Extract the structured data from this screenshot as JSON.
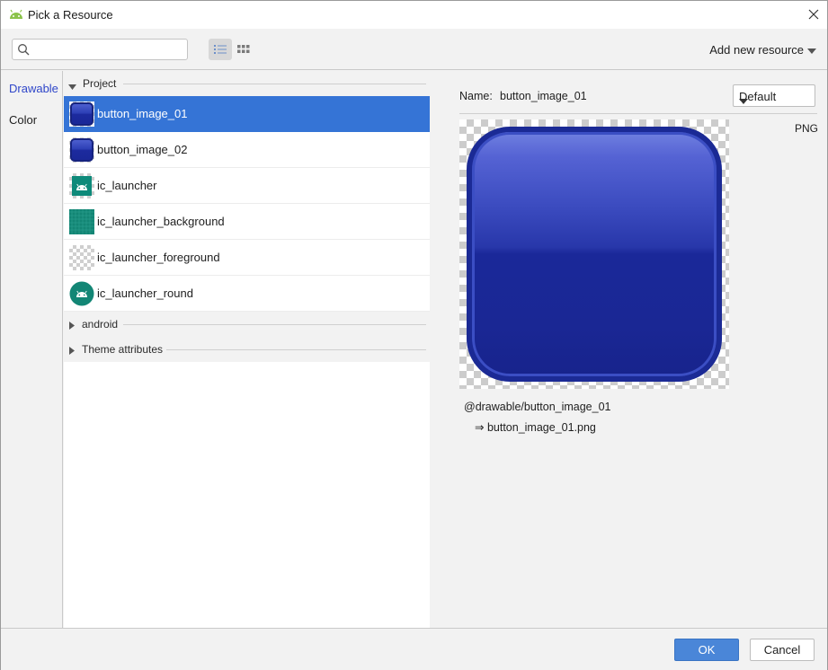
{
  "window": {
    "title": "Pick a Resource",
    "app_icon": "android-icon",
    "close_icon": "close-icon"
  },
  "toolbar": {
    "search": {
      "value": "",
      "placeholder": ""
    },
    "view_modes": [
      "list-view-icon",
      "grid-view-icon"
    ],
    "active_view": "list",
    "add_new_resource": "Add new resource"
  },
  "categories": [
    {
      "label": "Drawable",
      "active": true
    },
    {
      "label": "Color",
      "active": false
    }
  ],
  "list": {
    "groups": [
      {
        "label": "Project",
        "expanded": true,
        "items": [
          {
            "name": "button_image_01",
            "selected": true,
            "thumb": "blue-button"
          },
          {
            "name": "button_image_02",
            "selected": false,
            "thumb": "blue-button"
          },
          {
            "name": "ic_launcher",
            "selected": false,
            "thumb": "android-launcher"
          },
          {
            "name": "ic_launcher_background",
            "selected": false,
            "thumb": "teal-grid"
          },
          {
            "name": "ic_launcher_foreground",
            "selected": false,
            "thumb": "transparent"
          },
          {
            "name": "ic_launcher_round",
            "selected": false,
            "thumb": "android-round"
          }
        ]
      },
      {
        "label": "android",
        "expanded": false
      },
      {
        "label": "Theme attributes",
        "expanded": false
      }
    ]
  },
  "preview": {
    "name_label": "Name:",
    "name_value": "button_image_01",
    "density": "Default",
    "format": "PNG",
    "reference": "@drawable/button_image_01",
    "file": "⇒ button_image_01.png"
  },
  "footer": {
    "ok": "OK",
    "cancel": "Cancel"
  },
  "colors": {
    "selection": "#3574d6",
    "accent": "#2f46c9",
    "ok_button": "#4a86d8"
  }
}
